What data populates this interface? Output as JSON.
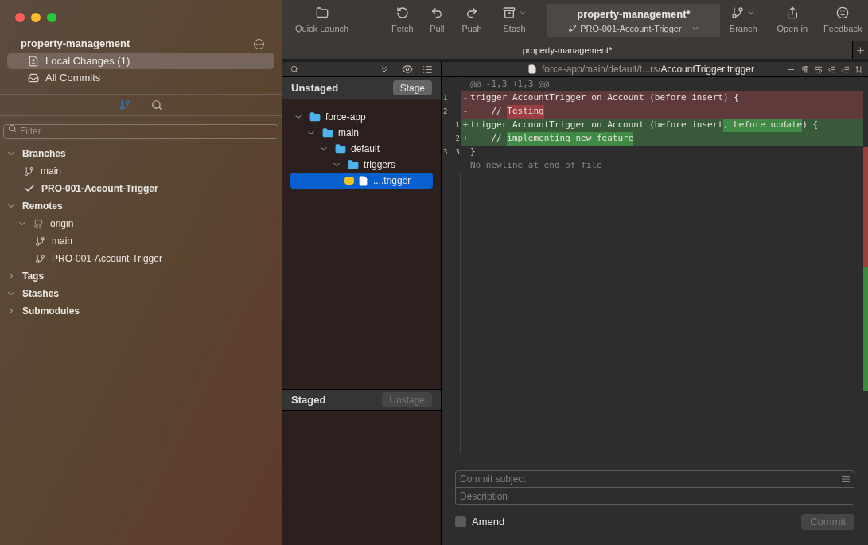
{
  "sidebar": {
    "repo_title": "property-management",
    "nav": [
      {
        "label": "Local Changes (1)",
        "selected": true
      },
      {
        "label": "All Commits",
        "selected": false
      }
    ],
    "modes": [
      {
        "selected": true
      },
      {
        "selected": false
      }
    ],
    "filter": {
      "placeholder": "Filter"
    },
    "tree": [
      {
        "label": "Branches",
        "expanded": true,
        "children": [
          {
            "label": "main",
            "kind": "branch",
            "current": false
          },
          {
            "label": "PRO-001-Account-Trigger",
            "kind": "branch",
            "current": true
          }
        ]
      },
      {
        "label": "Remotes",
        "expanded": true,
        "children": [
          {
            "label": "origin",
            "kind": "remote",
            "expanded": true,
            "children": [
              {
                "label": "main",
                "kind": "branch",
                "current": false
              },
              {
                "label": "PRO-001-Account-Trigger",
                "kind": "branch",
                "current": false
              }
            ]
          }
        ]
      },
      {
        "label": "Tags",
        "expanded": false
      },
      {
        "label": "Stashes",
        "expanded": true
      },
      {
        "label": "Submodules",
        "expanded": false
      }
    ]
  },
  "toolbar": {
    "buttons": [
      {
        "label": "Quick Launch",
        "dropdown": false
      },
      {
        "label": "Fetch",
        "dropdown": false
      },
      {
        "label": "Pull",
        "dropdown": false
      },
      {
        "label": "Push",
        "dropdown": false
      },
      {
        "label": "Stash",
        "dropdown": true
      }
    ],
    "repo": {
      "title": "property-management*",
      "branch": "PRO-001-Account-Trigger"
    },
    "right_buttons": [
      {
        "label": "Branch",
        "dropdown": true
      },
      {
        "label": "Open in",
        "dropdown": false
      },
      {
        "label": "Feedback",
        "dropdown": false
      }
    ]
  },
  "tabs": [
    {
      "label": "property-management*",
      "selected": true
    }
  ],
  "unstaged": {
    "title": "Unstaged",
    "button": {
      "label": "Stage",
      "disabled": false
    },
    "tree": [
      {
        "label": "force-app",
        "kind": "folder",
        "expanded": true,
        "selected": false,
        "children": [
          {
            "label": "main",
            "kind": "folder",
            "expanded": true,
            "selected": false,
            "children": [
              {
                "label": "default",
                "kind": "folder",
                "expanded": true,
                "selected": false,
                "children": [
                  {
                    "label": "triggers",
                    "kind": "folder",
                    "expanded": true,
                    "selected": false,
                    "children": [
                      {
                        "label": "....trigger",
                        "kind": "file",
                        "modified": true,
                        "selected": true
                      }
                    ]
                  }
                ]
              }
            ]
          }
        ]
      }
    ]
  },
  "staged": {
    "title": "Staged",
    "button": {
      "label": "Unstage",
      "disabled": true
    }
  },
  "diff": {
    "path_dim": "force-app/main/default/t...rs/",
    "path_name": "AccountTrigger.trigger",
    "lines": [
      {
        "kind": "hunk",
        "segments": [
          {
            "text": "@@ -1,3 +1,3 @@",
            "highlight": false
          }
        ]
      },
      {
        "kind": "removed",
        "old": "1",
        "sign": "-",
        "segments": [
          {
            "text": "trigger AccountTrigger on Account (before insert) {",
            "highlight": false
          }
        ]
      },
      {
        "kind": "removed",
        "old": "2",
        "sign": "-",
        "segments": [
          {
            "text": "    // ",
            "highlight": false
          },
          {
            "text": "Testing",
            "highlight": true
          }
        ]
      },
      {
        "kind": "added",
        "new": "1",
        "sign": "+",
        "segments": [
          {
            "text": "trigger AccountTrigger on Account (before insert",
            "highlight": false
          },
          {
            "text": ", before update",
            "highlight": true
          },
          {
            "text": ") {",
            "highlight": false
          }
        ]
      },
      {
        "kind": "added",
        "new": "2",
        "sign": "+",
        "segments": [
          {
            "text": "    // ",
            "highlight": false
          },
          {
            "text": "implementing new feature",
            "highlight": true
          }
        ]
      },
      {
        "kind": "context",
        "old": "3",
        "new": "3",
        "segments": [
          {
            "text": "}",
            "highlight": false
          }
        ]
      },
      {
        "kind": "note",
        "segments": [
          {
            "text": "No newline at end of file",
            "highlight": false
          }
        ]
      }
    ]
  },
  "commit": {
    "subject_placeholder": "Commit subject",
    "description_placeholder": "Description",
    "amend": {
      "label": "Amend",
      "checked": false
    },
    "button": {
      "label": "Commit",
      "disabled": true
    }
  }
}
